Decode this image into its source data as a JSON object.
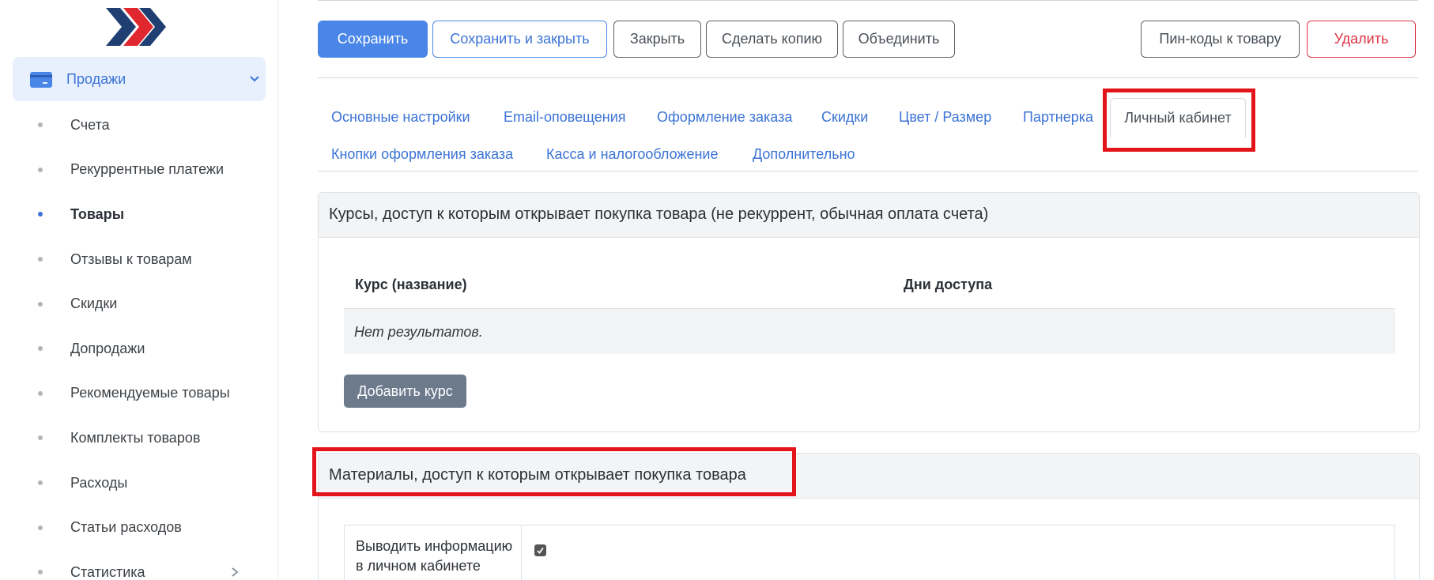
{
  "sidebar": {
    "sales_label": "Продажи",
    "items": [
      {
        "label": "Счета"
      },
      {
        "label": "Рекуррентные платежи"
      },
      {
        "label": "Товары"
      },
      {
        "label": "Отзывы к товарам"
      },
      {
        "label": "Скидки"
      },
      {
        "label": "Допродажи"
      },
      {
        "label": "Рекомендуемые товары"
      },
      {
        "label": "Комплекты товаров"
      },
      {
        "label": "Расходы"
      },
      {
        "label": "Статьи расходов"
      },
      {
        "label": "Статистика"
      }
    ],
    "active_item": "Товары",
    "colors": {
      "logo_dark": "#1f3f73",
      "logo_red": "#e0262f",
      "accent": "#3b73d6"
    }
  },
  "toolbar": {
    "save": "Сохранить",
    "save_close": "Сохранить и закрыть",
    "close": "Закрыть",
    "copy": "Сделать копию",
    "merge": "Объединить",
    "pins": "Пин-коды к товару",
    "delete": "Удалить"
  },
  "tabs": {
    "row1": [
      "Основные настройки",
      "Email-оповещения",
      "Оформление заказа",
      "Скидки",
      "Цвет / Размер",
      "Партнерка"
    ],
    "active": "Личный кабинет",
    "row2": [
      "Кнопки оформления заказа",
      "Касса и налогообложение",
      "Дополнительно"
    ]
  },
  "courses": {
    "title": "Курсы, доступ к которым открывает покупка товара (не рекуррент, обычная оплата счета)",
    "col_course": "Курс (название)",
    "col_days": "Дни доступа",
    "empty": "Нет результатов.",
    "add_button": "Добавить курс"
  },
  "materials": {
    "title": "Материалы, доступ к которым открывает покупка товара",
    "show_info_label": "Выводить информацию в личном кабинете",
    "show_info_checked": true
  },
  "highlight_color": "#e3151a"
}
